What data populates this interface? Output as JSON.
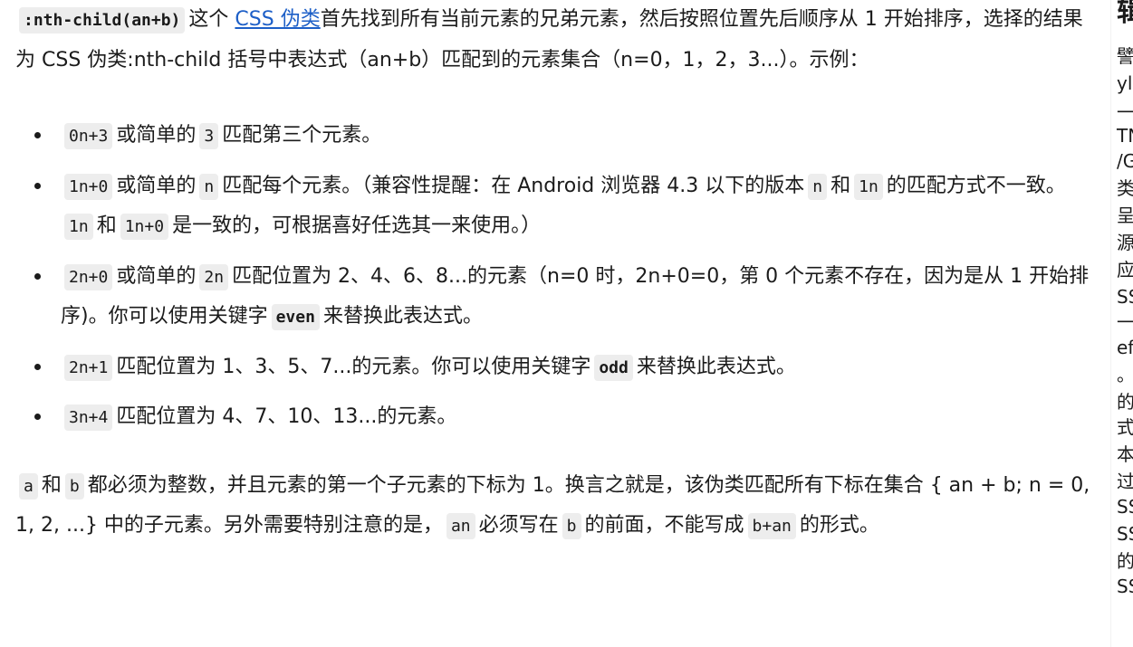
{
  "intro": {
    "code": ":nth-child(an+b)",
    "text1": "这个",
    "link": "CSS 伪类",
    "text2": "首先找到所有当前元素的兄弟元素，然后按照位置先后顺序从 1 开始排序，选择的结果为 CSS 伪类:nth-child 括号中表达式（an+b）匹配到的元素集合（n=0，1，2，3...）。示例："
  },
  "items": [
    {
      "c1": "0n+3",
      "t1": "或简单的",
      "c2": "3",
      "t2": "匹配第三个元素。"
    },
    {
      "c1": "1n+0",
      "t1": "或简单的",
      "c2": "n",
      "t2": "匹配每个元素。（兼容性提醒：在 Android 浏览器 4.3 以下的版本",
      "c3": "n",
      "t3": "和",
      "c4": "1n",
      "t4": "的匹配方式不一致。",
      "c5": "1n",
      "t5": "和",
      "c6": "1n+0",
      "t6": "是一致的，可根据喜好任选其一来使用。）"
    },
    {
      "c1": "2n+0",
      "t1": "或简单的",
      "c2": "2n",
      "t2": "匹配位置为 2、4、6、8...的元素（n=0 时，2n+0=0，第 0 个元素不存在，因为是从 1 开始排序)。你可以使用关键字",
      "c3": "even",
      "t3": "来替换此表达式。"
    },
    {
      "c1": "2n+1",
      "t1": "匹配位置为 1、3、5、7...的元素。你可以使用关键字",
      "c2": "odd",
      "t2": "来替换此表达式。"
    },
    {
      "c1": "3n+4",
      "t1": "匹配位置为 4、7、10、13...的元素。"
    }
  ],
  "outro": {
    "c1": "a",
    "t1": "和",
    "c2": "b",
    "t2": "都必须为整数，并且元素的第一个子元素的下标为 1。换言之就是，该伪类匹配所有下标在集合 { an + b; n = 0, 1, 2, ...} 中的子元素。另外需要特别注意的是，",
    "c3": "an",
    "t3": "必须写在",
    "c4": "b",
    "t4": "的前面，不能写成",
    "c5": "b+an",
    "t5": "的形式。"
  },
  "sidebar": {
    "fragments": [
      "辑",
      "譬",
      "yl",
      "一",
      "TN",
      "/G",
      "类",
      "呈",
      "源",
      "应",
      "SS",
      "一",
      "ef",
      "。",
      "的",
      "式",
      "本",
      "过",
      "SS",
      "SS",
      "的",
      "SS"
    ]
  },
  "colors": {
    "link": "#1d5fc7",
    "code_bg": "#ededed",
    "text": "#1b1b1b"
  }
}
